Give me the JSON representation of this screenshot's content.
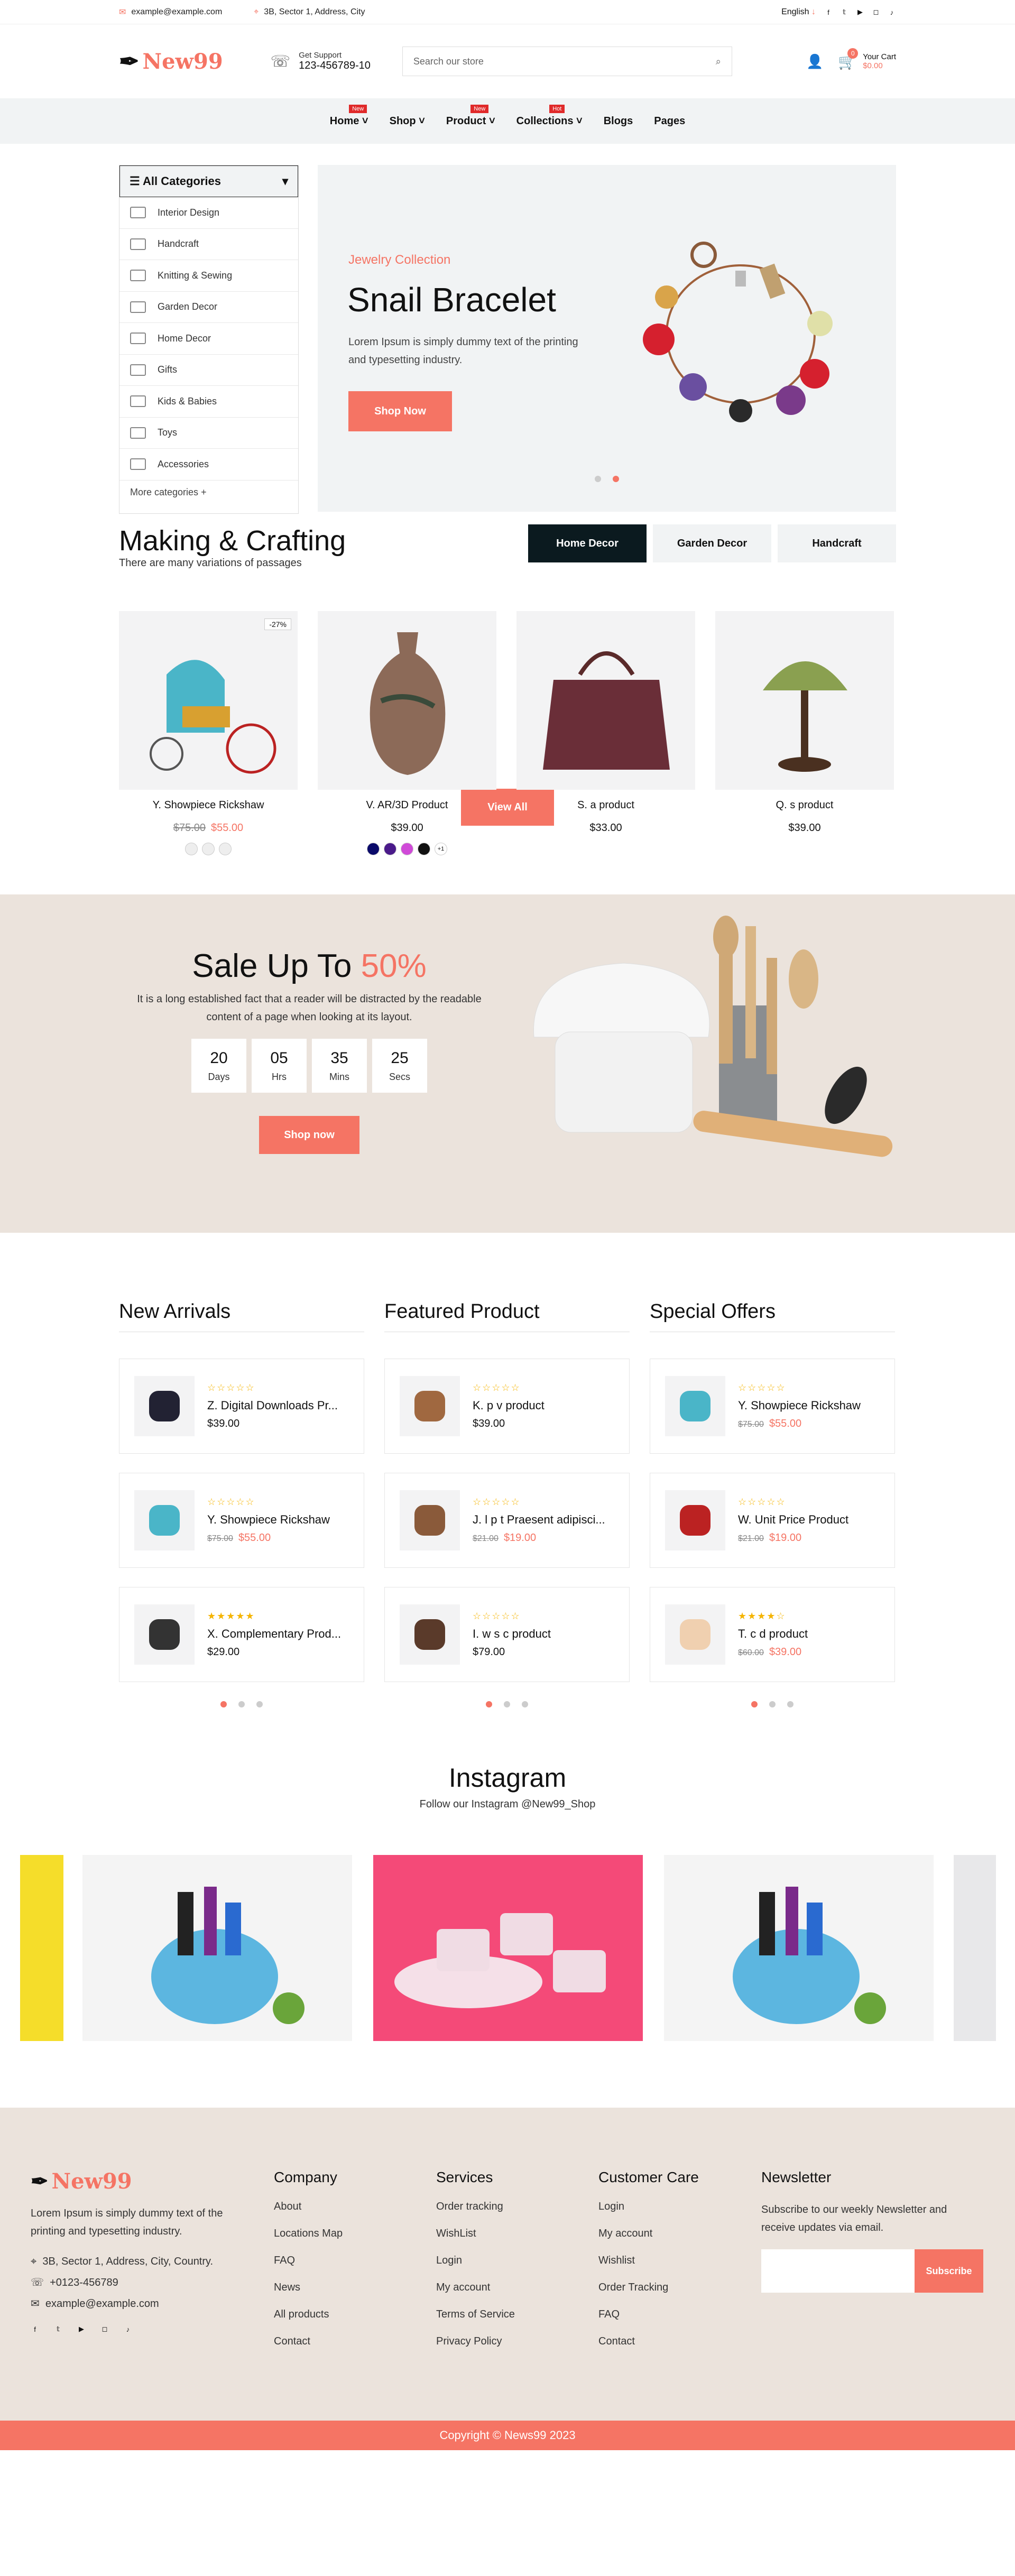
{
  "topbar": {
    "email": "example@example.com",
    "address": "3B, Sector 1, Address, City",
    "language": "English",
    "socials": [
      "facebook-icon",
      "twitter-icon",
      "youtube-icon",
      "instagram-icon",
      "tiktok-icon"
    ]
  },
  "header": {
    "logo": "New99",
    "support_label": "Get Support",
    "support_phone": "123-456789-10",
    "search_placeholder": "Search our store",
    "cart_label": "Your Cart",
    "cart_total": "$0.00",
    "cart_count": "0"
  },
  "nav": {
    "items": [
      {
        "label": "Home",
        "badge": "New"
      },
      {
        "label": "Shop",
        "badge": ""
      },
      {
        "label": "Product",
        "badge": "New"
      },
      {
        "label": "Collections",
        "badge": "Hot"
      },
      {
        "label": "Blogs",
        "badge": ""
      },
      {
        "label": "Pages",
        "badge": ""
      }
    ]
  },
  "categories": {
    "title": "All Categories",
    "items": [
      "Interior Design",
      "Handcraft",
      "Knitting & Sewing",
      "Garden Decor",
      "Home Decor",
      "Gifts",
      "Kids & Babies",
      "Toys",
      "Accessories"
    ],
    "more": "More categories"
  },
  "hero": {
    "subtitle": "Jewelry Collection",
    "title": "Snail Bracelet",
    "text": "Lorem Ipsum is simply dummy text of the printing and typesetting industry.",
    "button": "Shop Now"
  },
  "making": {
    "title": "Making & Crafting",
    "subtitle": "There are many variations of passages",
    "tabs": [
      "Home Decor",
      "Garden Decor",
      "Handcraft"
    ],
    "view_all": "View All",
    "products": [
      {
        "name": "Y. Showpiece Rickshaw",
        "old": "$75.00",
        "price": "$55.00",
        "badge": "-27%"
      },
      {
        "name": "V. AR/3D Product",
        "old": "",
        "price": "$39.00",
        "badge": "",
        "more": "+1"
      },
      {
        "name": "S. a product",
        "old": "",
        "price": "$33.00",
        "badge": ""
      },
      {
        "name": "Q. s product",
        "old": "",
        "price": "$39.00",
        "badge": ""
      }
    ]
  },
  "sale": {
    "title": "Sale Up To",
    "percent": "50%",
    "text": "It is a long established fact that a reader will be distracted by the readable content of a page when looking at its layout.",
    "countdown": [
      {
        "v": "20",
        "l": "Days"
      },
      {
        "v": "05",
        "l": "Hrs"
      },
      {
        "v": "35",
        "l": "Mins"
      },
      {
        "v": "25",
        "l": "Secs"
      }
    ],
    "button": "Shop now"
  },
  "lists": [
    {
      "title": "New Arrivals",
      "items": [
        {
          "name": "Z. Digital Downloads Pr...",
          "old": "",
          "price": "$39.00",
          "stars": 0
        },
        {
          "name": "Y. Showpiece Rickshaw",
          "old": "$75.00",
          "price": "$55.00",
          "stars": 0
        },
        {
          "name": "X. Complementary Prod...",
          "old": "",
          "price": "$29.00",
          "stars": 5
        }
      ]
    },
    {
      "title": "Featured Product",
      "items": [
        {
          "name": "K. p v product",
          "old": "",
          "price": "$39.00",
          "stars": 0
        },
        {
          "name": "J. l p t Praesent adipisci...",
          "old": "$21.00",
          "price": "$19.00",
          "stars": 0
        },
        {
          "name": "I. w s c product",
          "old": "",
          "price": "$79.00",
          "stars": 0
        }
      ]
    },
    {
      "title": "Special Offers",
      "items": [
        {
          "name": "Y. Showpiece Rickshaw",
          "old": "$75.00",
          "price": "$55.00",
          "stars": 0
        },
        {
          "name": "W. Unit Price Product",
          "old": "$21.00",
          "price": "$19.00",
          "stars": 0
        },
        {
          "name": "T. c d product",
          "old": "$60.00",
          "price": "$39.00",
          "stars": 4
        }
      ]
    }
  ],
  "instagram": {
    "title": "Instagram",
    "subtitle": "Follow our Instagram @New99_Shop"
  },
  "footer": {
    "about": "Lorem Ipsum is simply dummy text of the printing and typesetting industry.",
    "address": "3B, Sector 1, Address, City, Country.",
    "phone": "+0123-456789",
    "email": "example@example.com",
    "company": {
      "title": "Company",
      "links": [
        "About",
        "Locations Map",
        "FAQ",
        "News",
        "All products",
        "Contact"
      ]
    },
    "services": {
      "title": "Services",
      "links": [
        "Order tracking",
        "WishList",
        "Login",
        "My account",
        "Terms of Service",
        "Privacy Policy"
      ]
    },
    "care": {
      "title": "Customer Care",
      "links": [
        "Login",
        "My account",
        "Wishlist",
        "Order Tracking",
        "FAQ",
        "Contact"
      ]
    },
    "newsletter": {
      "title": "Newsletter",
      "text": "Subscribe to our weekly Newsletter and receive updates via email.",
      "button": "Subscribe"
    },
    "copyright": "Copyright © News99 2023"
  },
  "colors": {
    "accent": "#f57464",
    "dark": "#0b1a1f",
    "beige": "#ebe3dc",
    "light": "#f1f3f4"
  }
}
